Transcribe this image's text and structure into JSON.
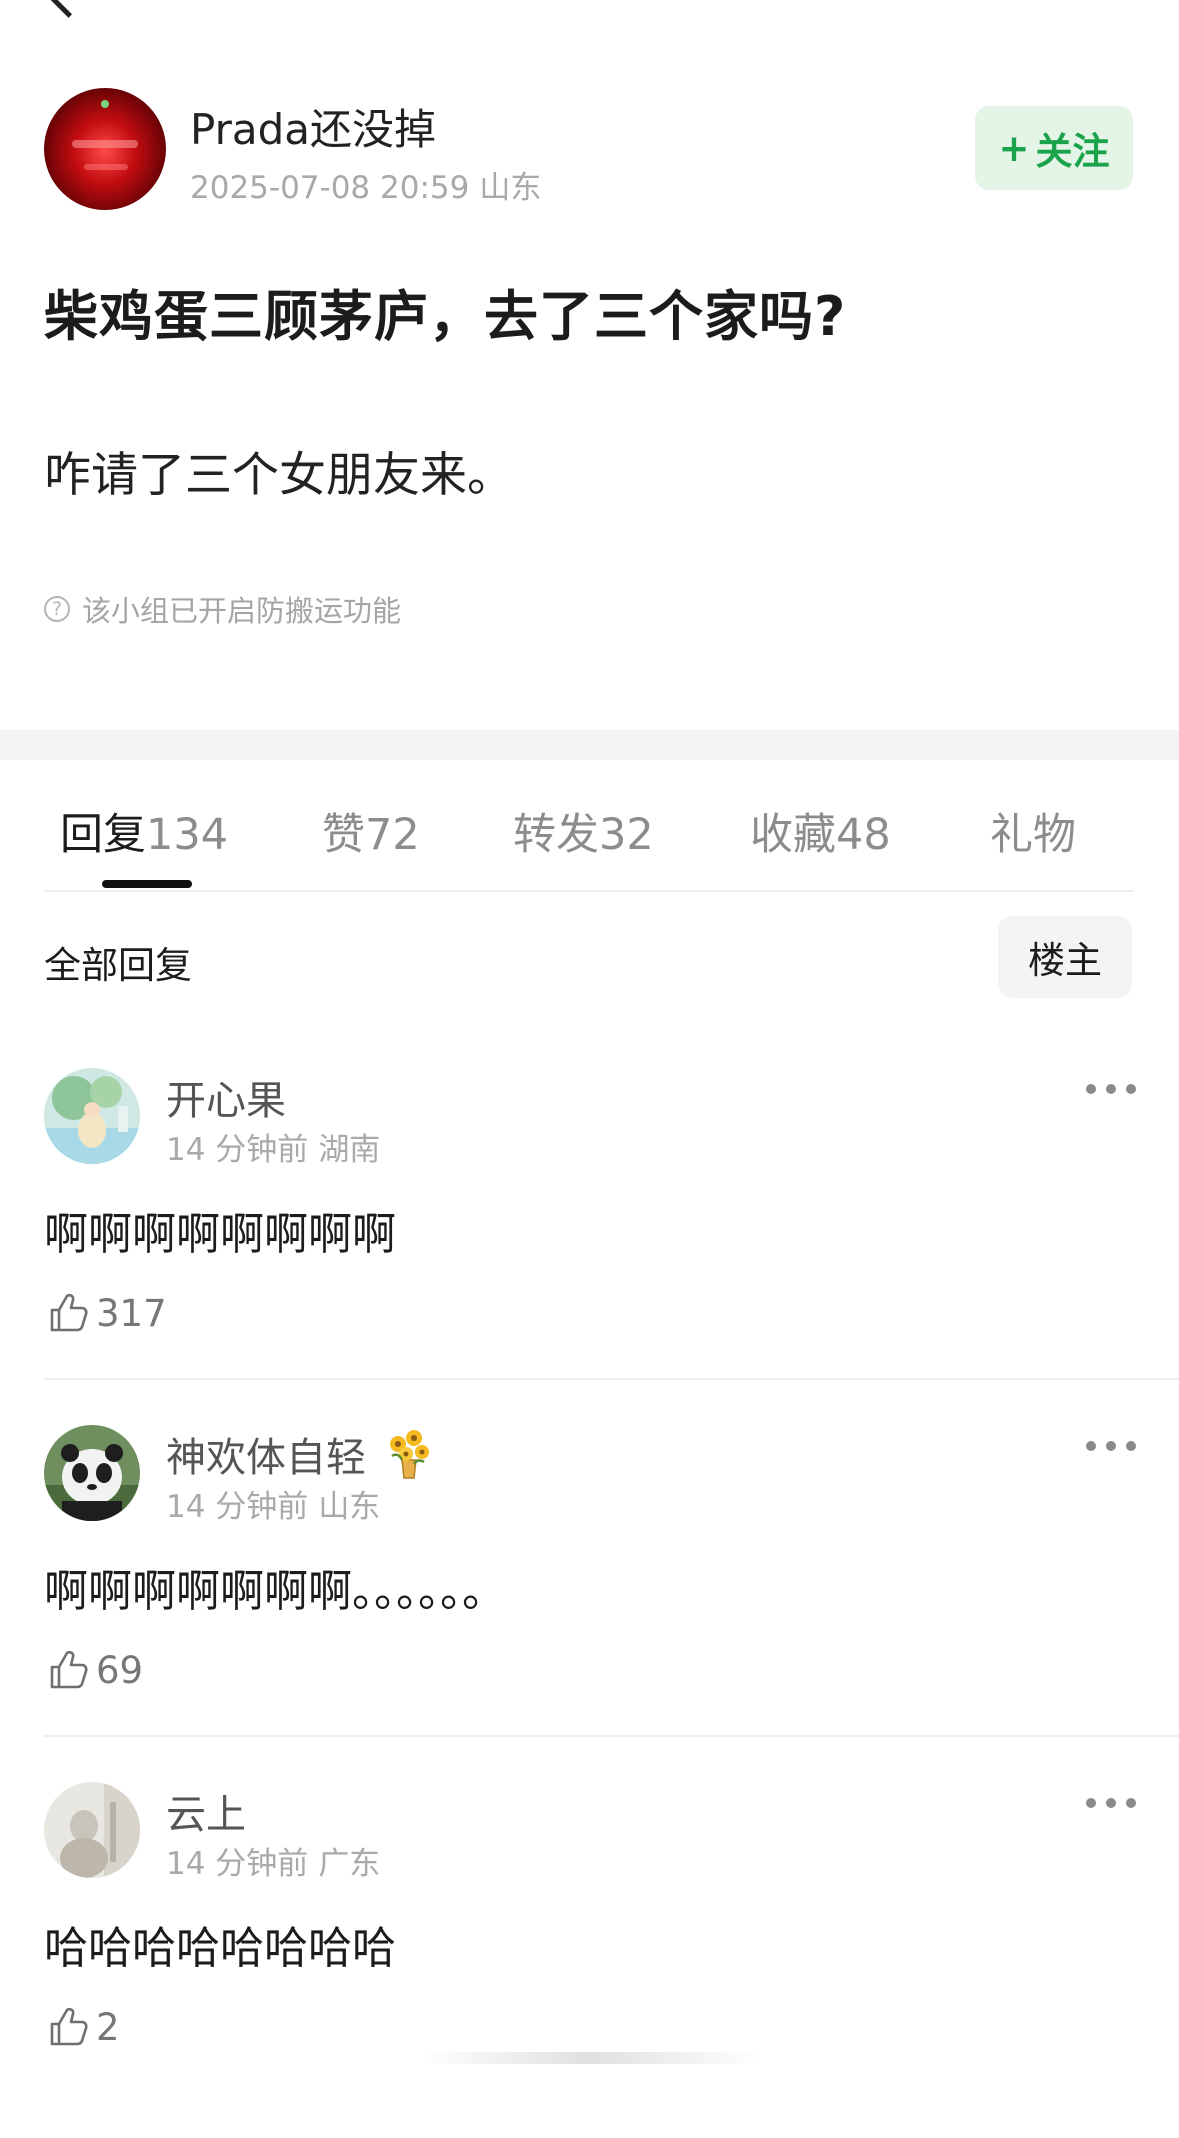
{
  "author": {
    "name": "Prada还没掉",
    "datetime": "2025-07-08 20:59",
    "location": "山东",
    "follow_label": "关注",
    "follow_symbol": "+"
  },
  "post": {
    "title": "柴鸡蛋三顾茅庐，去了三个家吗?",
    "body": "咋请了三个女朋友来。",
    "notice": "该小组已开启防搬运功能"
  },
  "tabs": [
    {
      "label": "回复",
      "count": "134",
      "active": true
    },
    {
      "label": "赞",
      "count": "72",
      "active": false
    },
    {
      "label": "转发",
      "count": "32",
      "active": false
    },
    {
      "label": "收藏",
      "count": "48",
      "active": false
    },
    {
      "label": "礼物",
      "count": "",
      "active": false
    }
  ],
  "filter": {
    "label": "全部回复",
    "op_only_label": "楼主"
  },
  "comments": [
    {
      "name": "开心果",
      "time": "14 分钟前",
      "location": "湖南",
      "text": "啊啊啊啊啊啊啊啊",
      "likes": "317",
      "avatar": "avatar-scenery-illustration",
      "badge": ""
    },
    {
      "name": "神欢体自轻",
      "time": "14 分钟前",
      "location": "山东",
      "text": "啊啊啊啊啊啊啊。。。。。。",
      "likes": "69",
      "avatar": "avatar-panda",
      "badge": "sunflower-vase-icon"
    },
    {
      "name": "云上",
      "time": "14 分钟前",
      "location": "广东",
      "text": "哈哈哈哈哈哈哈哈",
      "likes": "2",
      "avatar": "avatar-figure-sketch",
      "badge": ""
    }
  ],
  "colors": {
    "follow_bg": "#e4f5e8",
    "follow_text": "#1aa34a",
    "muted": "#a9a9a9",
    "divider": "#f3f3f3"
  }
}
